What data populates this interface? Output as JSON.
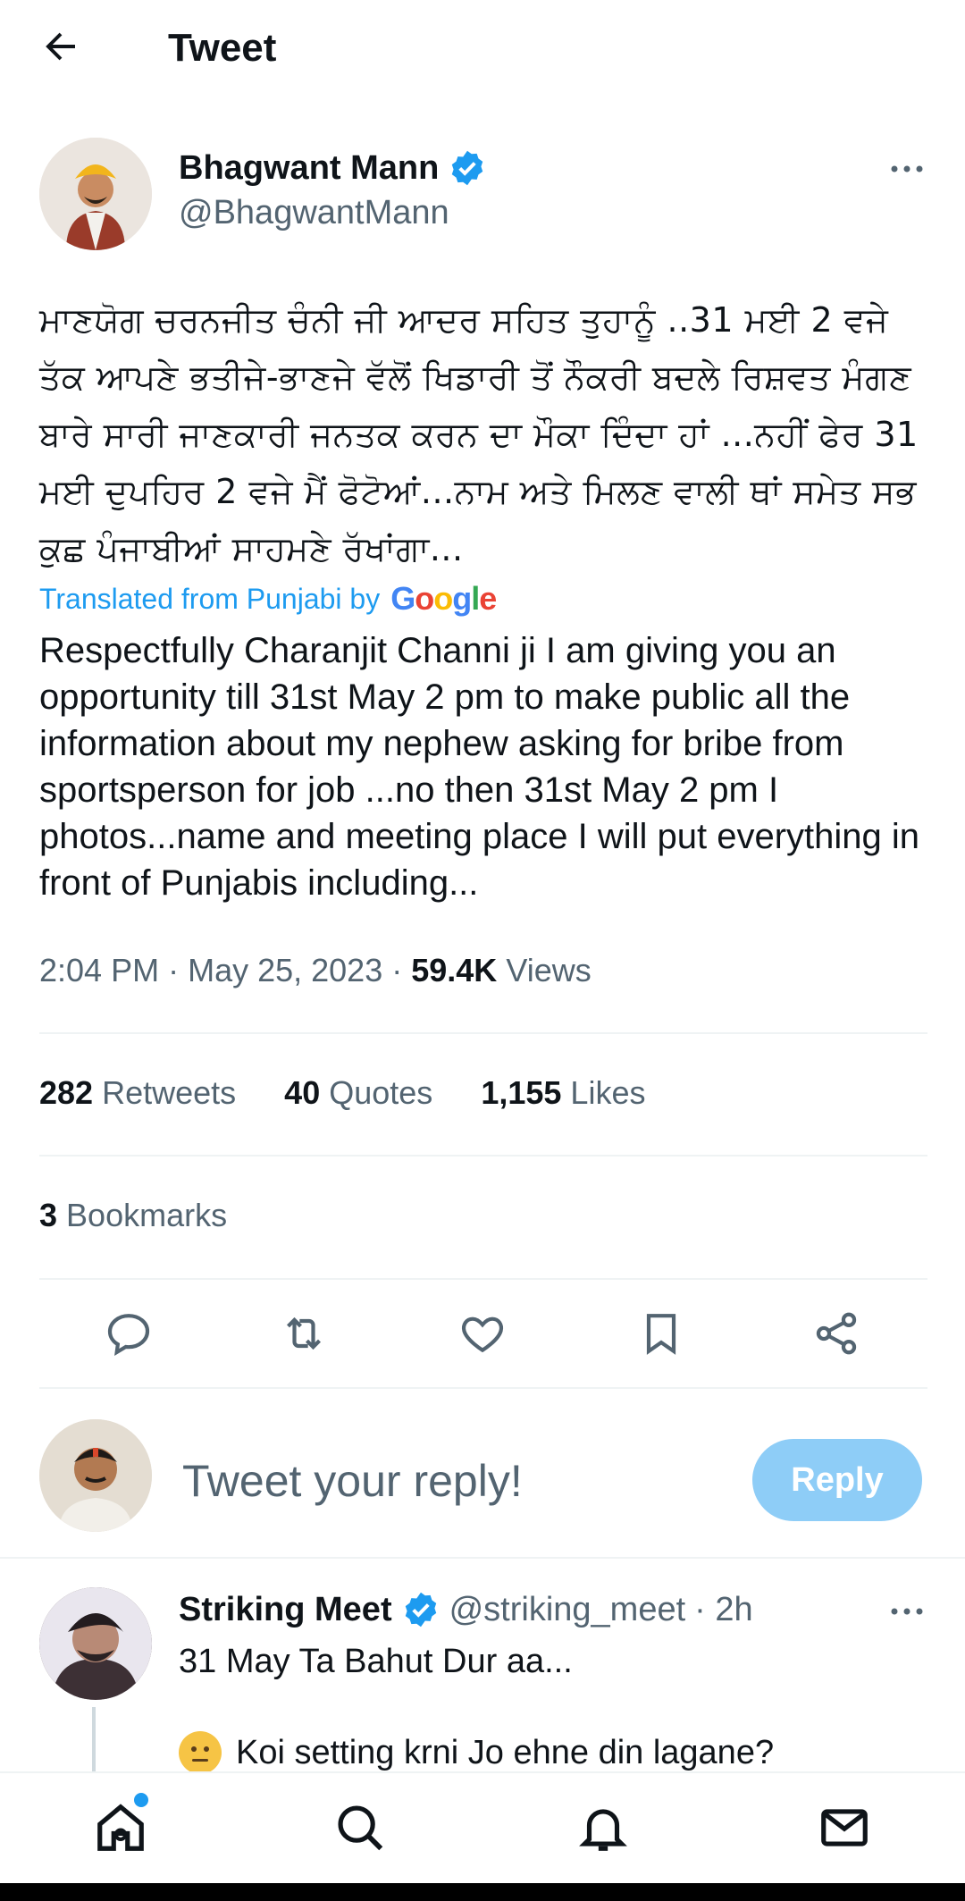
{
  "header": {
    "title": "Tweet"
  },
  "tweet": {
    "author_name": "Bhagwant Mann",
    "author_handle": "@BhagwantMann",
    "punjabi_text": "ਮਾਣਯੋਗ ਚਰਨਜੀਤ  ਚੰਨੀ ਜੀ ਆਦਰ ਸਹਿਤ ਤੁਹਾਨੂੰ ..31 ਮਈ 2 ਵਜੇ ਤੱਕ ਆਪਣੇ ਭਤੀਜੇ-ਭਾਣਜੇ ਵੱਲੋਂ ਖਿਡਾਰੀ ਤੋਂ ਨੌਕਰੀ ਬਦਲੇ ਰਿਸ਼ਵਤ ਮੰਗਣ ਬਾਰੇ ਸਾਰੀ ਜਾਣਕਾਰੀ ਜਨਤਕ ਕਰਨ ਦਾ ਮੌਕਾ ਦਿੰਦਾ ਹਾਂ ...ਨਹੀਂ ਫੇਰ 31 ਮਈ ਦੁਪਹਿਰ 2 ਵਜੇ ਮੈਂ ਫੋਟੋਆਂ...ਨਾਮ ਅਤੇ ਮਿਲਣ ਵਾਲੀ ਥਾਂ ਸਮੇਤ ਸਭ ਕੁਛ ਪੰਜਾਬੀਆਂ ਸਾਹਮਣੇ ਰੱਖਾਂਗਾ...",
    "translated_label": "Translated from Punjabi by",
    "google_label": "Google",
    "translated_text": "Respectfully Charanjit Channi ji I am giving you an opportunity till 31st May 2 pm to make public all the information about my nephew asking for bribe from sportsperson for job ...no then 31st May 2 pm I photos...name and meeting place I will put everything in front of Punjabis including...",
    "time": "2:04 PM",
    "date": "May 25, 2023",
    "views_count": "59.4K",
    "views_label": "Views",
    "retweets_count": "282",
    "retweets_label": "Retweets",
    "quotes_count": "40",
    "quotes_label": "Quotes",
    "likes_count": "1,155",
    "likes_label": "Likes",
    "bookmarks_count": "3",
    "bookmarks_label": "Bookmarks"
  },
  "actions": [
    "reply-icon",
    "retweet-icon",
    "like-icon",
    "bookmark-icon",
    "share-icon"
  ],
  "reply_box": {
    "placeholder": "Tweet your reply!",
    "button_label": "Reply"
  },
  "comment": {
    "name": "Striking Meet",
    "handle": "@striking_meet",
    "time": "· 2h",
    "line1": "31 May Ta Bahut Dur aa...",
    "line2": "Koi setting krni Jo ehne din lagane?"
  },
  "nav": [
    "home-icon",
    "search-icon",
    "notifications-icon",
    "messages-icon"
  ],
  "colors": {
    "accent": "#1d9bf0",
    "reply_button": "#8ecdf7",
    "muted": "#536471",
    "text": "#0f1419"
  }
}
